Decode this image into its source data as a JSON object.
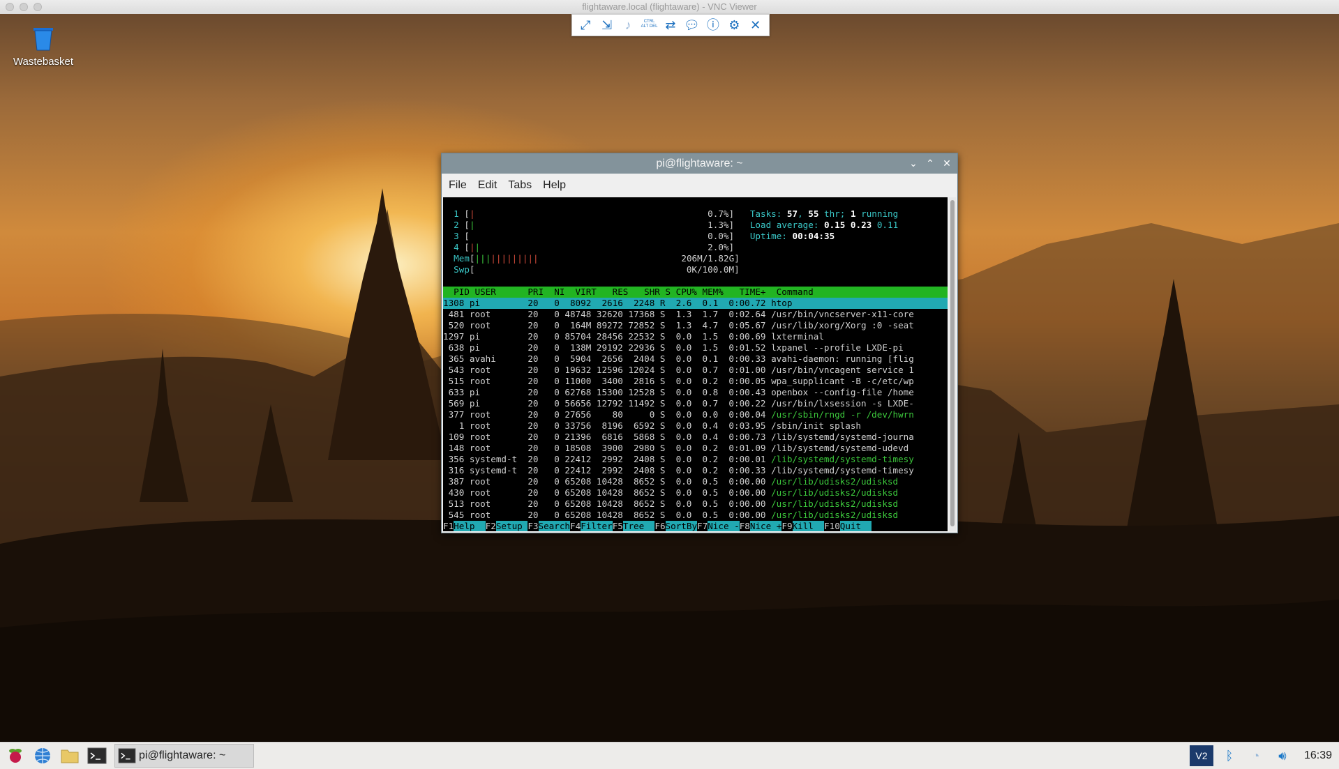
{
  "vnc": {
    "window_title": "flightaware.local (flightaware) - VNC Viewer",
    "toolbar": [
      "fullscreen-icon",
      "scale-icon",
      "audio-icon",
      "ctrl-alt-del-icon",
      "transfer-icon",
      "chat-icon",
      "info-icon",
      "settings-icon",
      "close-icon"
    ],
    "ctrl_alt_del_label": "CTRL ALT DEL"
  },
  "desktop": {
    "wastebasket_label": "Wastebasket"
  },
  "terminal": {
    "title": "pi@flightaware: ~",
    "menu": [
      "File",
      "Edit",
      "Tabs",
      "Help"
    ]
  },
  "htop": {
    "cpus": [
      {
        "id": "1",
        "bar": "|",
        "pct": "0.7%"
      },
      {
        "id": "2",
        "bar": "|",
        "pct": "1.3%"
      },
      {
        "id": "3",
        "bar": "",
        "pct": "0.0%"
      },
      {
        "id": "4",
        "bar": "||",
        "pct": "2.0%"
      }
    ],
    "mem": {
      "label": "Mem",
      "bar": "||||||||||||",
      "value": "206M/1.82G"
    },
    "swp": {
      "label": "Swp",
      "bar": "",
      "value": "0K/100.0M"
    },
    "tasks": {
      "total": "57",
      "threads": "55",
      "running": "1"
    },
    "load": {
      "one": "0.15",
      "five": "0.23",
      "fifteen": "0.11"
    },
    "uptime": "00:04:35",
    "header": "  PID USER      PRI  NI  VIRT   RES   SHR S CPU% MEM%   TIME+  Command",
    "rows": [
      "1308 pi         20   0  8092  2616  2248 R  2.6  0.1  0:00.72 htop",
      " 481 root       20   0 48748 32620 17368 S  1.3  1.7  0:02.64 /usr/bin/vncserver-x11-core",
      " 520 root       20   0  164M 89272 72852 S  1.3  4.7  0:05.67 /usr/lib/xorg/Xorg :0 -seat",
      "1297 pi         20   0 85704 28456 22532 S  0.0  1.5  0:00.69 lxterminal",
      " 638 pi         20   0  138M 29192 22936 S  0.0  1.5  0:01.52 lxpanel --profile LXDE-pi",
      " 365 avahi      20   0  5904  2656  2404 S  0.0  0.1  0:00.33 avahi-daemon: running [flig",
      " 543 root       20   0 19632 12596 12024 S  0.0  0.7  0:01.00 /usr/bin/vncagent service 1",
      " 515 root       20   0 11000  3400  2816 S  0.0  0.2  0:00.05 wpa_supplicant -B -c/etc/wp",
      " 633 pi         20   0 62768 15300 12528 S  0.0  0.8  0:00.43 openbox --config-file /home",
      " 569 pi         20   0 56656 12792 11492 S  0.0  0.7  0:00.22 /usr/bin/lxsession -s LXDE-",
      " 377 root       20   0 27656    80     0 S  0.0  0.0  0:00.04 /usr/sbin/rngd -r /dev/hwrn",
      "   1 root       20   0 33756  8196  6592 S  0.0  0.4  0:03.95 /sbin/init splash",
      " 109 root       20   0 21396  6816  5868 S  0.0  0.4  0:00.73 /lib/systemd/systemd-journa",
      " 148 root       20   0 18508  3900  2980 S  0.0  0.2  0:01.09 /lib/systemd/systemd-udevd",
      " 356 systemd-t  20   0 22412  2992  2408 S  0.0  0.2  0:00.01 /lib/systemd/systemd-timesy",
      " 316 systemd-t  20   0 22412  2992  2408 S  0.0  0.2  0:00.33 /lib/systemd/systemd-timesy",
      " 387 root       20   0 65208 10428  8652 S  0.0  0.5  0:00.00 /usr/lib/udisks2/udisksd",
      " 430 root       20   0 65208 10428  8652 S  0.0  0.5  0:00.00 /usr/lib/udisks2/udisksd",
      " 513 root       20   0 65208 10428  8652 S  0.0  0.5  0:00.00 /usr/lib/udisks2/udisksd",
      " 545 root       20   0 65208 10428  8652 S  0.0  0.5  0:00.00 /usr/lib/udisks2/udisksd"
    ],
    "green_rows": [
      10,
      14,
      16,
      17,
      18,
      19
    ],
    "fkeys": [
      {
        "k": "F1",
        "l": "Help  "
      },
      {
        "k": "F2",
        "l": "Setup "
      },
      {
        "k": "F3",
        "l": "Search"
      },
      {
        "k": "F4",
        "l": "Filter"
      },
      {
        "k": "F5",
        "l": "Tree  "
      },
      {
        "k": "F6",
        "l": "SortBy"
      },
      {
        "k": "F7",
        "l": "Nice -"
      },
      {
        "k": "F8",
        "l": "Nice +"
      },
      {
        "k": "F9",
        "l": "Kill  "
      },
      {
        "k": "F10",
        "l": "Quit  "
      }
    ]
  },
  "taskbar": {
    "task_label": "pi@flightaware: ~",
    "clock": "16:39",
    "tray": [
      "vnc-icon",
      "bluetooth-icon",
      "wifi-icon",
      "volume-icon"
    ]
  }
}
